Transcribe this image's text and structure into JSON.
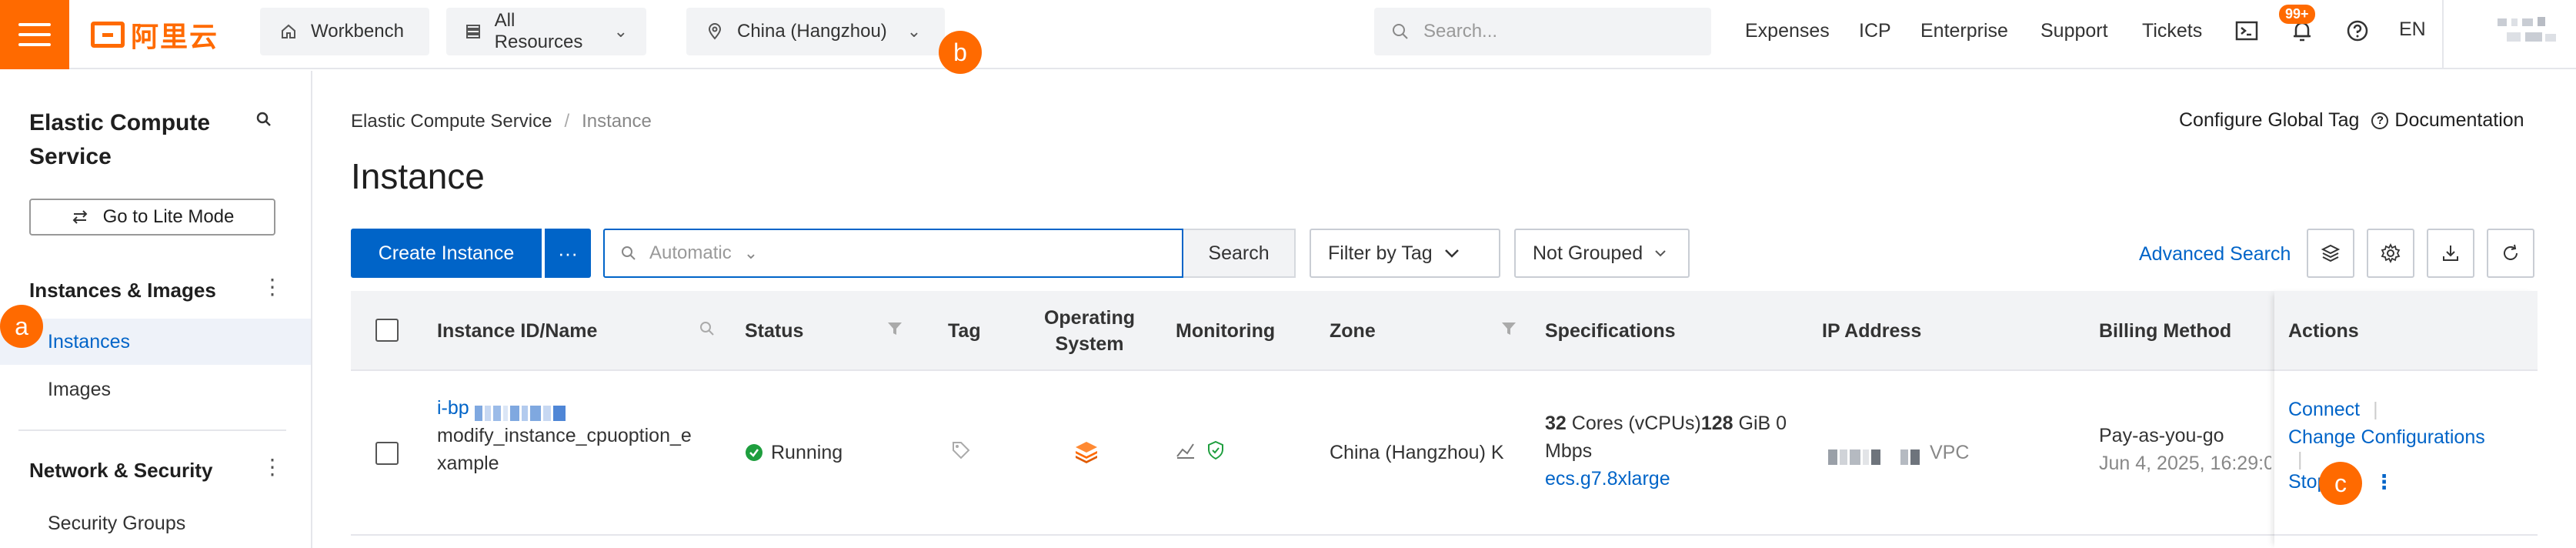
{
  "topbar": {
    "logo_text": "阿里云",
    "workbench": "Workbench",
    "all_resources": "All Resources",
    "region": "China (Hangzhou)",
    "search_placeholder": "Search...",
    "links": [
      "Expenses",
      "ICP",
      "Enterprise",
      "Support",
      "Tickets"
    ],
    "notification_badge": "99+",
    "language": "EN"
  },
  "markers": {
    "a": "a",
    "b": "b",
    "c": "c"
  },
  "sidebar": {
    "title": "Elastic Compute Service",
    "lite_mode_button": "Go to Lite Mode",
    "groups": [
      {
        "label": "Instances & Images",
        "items": [
          "Instances",
          "Images"
        ]
      },
      {
        "label": "Network & Security",
        "items": [
          "Security Groups"
        ]
      }
    ]
  },
  "breadcrumb": {
    "root": "Elastic Compute Service",
    "separator": "/",
    "current": "Instance"
  },
  "page": {
    "title": "Instance",
    "configure_global_tag": "Configure Global Tag",
    "documentation": "Documentation"
  },
  "toolbar": {
    "create_instance": "Create Instance",
    "more": "···",
    "search_mode": "Automatic",
    "search_button": "Search",
    "filter_by_tag": "Filter by Tag",
    "grouping": "Not Grouped",
    "advanced_search": "Advanced Search"
  },
  "table": {
    "columns": {
      "instance": "Instance ID/Name",
      "status": "Status",
      "tag": "Tag",
      "os": "Operating System",
      "monitoring": "Monitoring",
      "zone": "Zone",
      "specs": "Specifications",
      "ip": "IP Address",
      "billing": "Billing Method",
      "actions": "Actions"
    },
    "rows": [
      {
        "id_prefix": "i-bp",
        "name": "modify_instance_cpuoption_example",
        "status": "Running",
        "zone": "China (Hangzhou) K",
        "specs_cores": "32",
        "specs_cores_unit": "Cores (vCPUs)",
        "specs_mem": "128",
        "specs_mem_unit": "GiB 0 Mbps",
        "instance_type": "ecs.g7.8xlarge",
        "ip_suffix": "VPC",
        "billing": "Pay-as-you-go",
        "created": "Jun 4, 2025, 16:29:0",
        "actions": {
          "connect": "Connect",
          "change": "Change Configurations",
          "stop": "Stop"
        }
      }
    ]
  },
  "colors": {
    "brand": "#ff6a00",
    "primary": "#0064c8",
    "running": "#1e9e3e"
  }
}
